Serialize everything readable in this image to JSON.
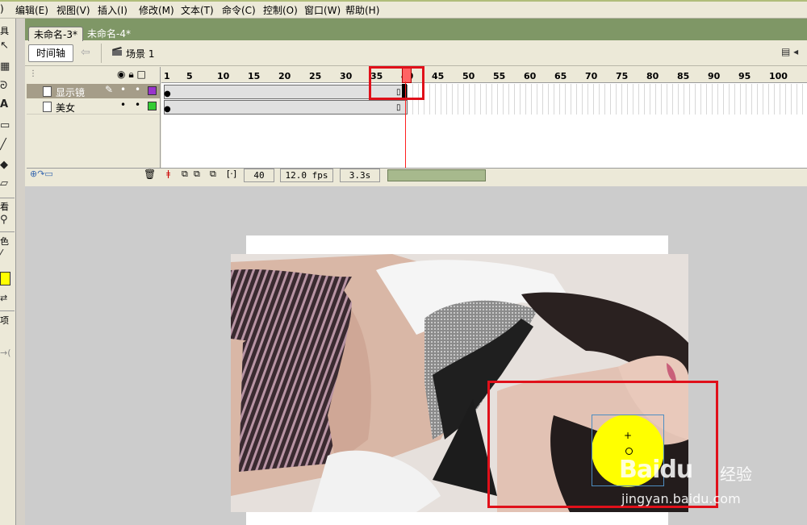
{
  "menu": {
    "items": [
      "编辑(E)",
      "视图(V)",
      "插入(I)",
      "修改(M)",
      "文本(T)",
      "命令(C)",
      "控制(O)",
      "窗口(W)",
      "帮助(H)"
    ]
  },
  "tools_panel": {
    "labels": [
      "具",
      "看",
      "色",
      "项"
    ]
  },
  "document_tabs": [
    {
      "label": "未命名-3*",
      "active": true
    },
    {
      "label": "未命名-4*",
      "active": false
    }
  ],
  "edit_bar": {
    "timeline_button": "时间轴",
    "scene_label": "场景 1"
  },
  "timeline": {
    "ruler_ticks": [
      "1",
      "5",
      "10",
      "15",
      "20",
      "25",
      "30",
      "35",
      "40",
      "45",
      "50",
      "55",
      "60",
      "65",
      "70",
      "75",
      "80",
      "85",
      "90",
      "95",
      "100"
    ],
    "layers": [
      {
        "name": "显示镜",
        "selected": true,
        "color": "#9933cc"
      },
      {
        "name": "美女",
        "selected": false,
        "color": "#33cc33"
      }
    ],
    "current_frame": "40",
    "frame_rate": "12.0 fps",
    "elapsed_time": "3.3s",
    "playhead_frame": 40
  },
  "stage": {
    "watermark_logo": "Baidu",
    "watermark_cn": "经验",
    "watermark_url": "jingyan.baidu.com",
    "highlight_color": "#e0101a",
    "circle_color": "#ffff00"
  }
}
